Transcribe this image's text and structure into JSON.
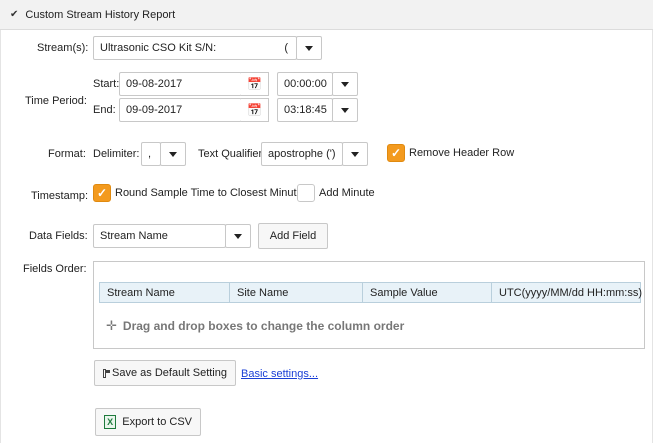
{
  "header": {
    "title": "Custom Stream History Report"
  },
  "stream": {
    "label": "Stream(s):",
    "value": "Ultrasonic CSO Kit S/N:",
    "extra": "("
  },
  "time_period": {
    "label": "Time Period:",
    "start_label": "Start:",
    "start_date": "09-08-2017",
    "start_time": "00:00:00",
    "end_label": "End:",
    "end_date": "09-09-2017",
    "end_time": "03:18:45"
  },
  "format": {
    "label": "Format:",
    "delimiter_label": "Delimiter:",
    "delimiter_value": ",",
    "qualifier_label": "Text Qualifier:",
    "qualifier_value": "apostrophe (')",
    "remove_header_label": "Remove Header Row",
    "remove_header_checked": true
  },
  "timestamp": {
    "label": "Timestamp:",
    "round_label": "Round Sample Time to Closest Minute",
    "round_checked": true,
    "add_minute_label": "Add Minute",
    "add_minute_checked": false
  },
  "data_fields": {
    "label": "Data Fields:",
    "value": "Stream Name",
    "add_label": "Add Field"
  },
  "fields_order": {
    "label": "Fields Order:",
    "columns": [
      "Stream Name",
      "Site Name",
      "Sample Value",
      "UTC(yyyy/MM/dd HH:mm:ss)"
    ],
    "hint": "Drag and drop boxes to change the column order"
  },
  "actions": {
    "save_default_label": "Save as Default Setting",
    "basic_settings_label": "Basic settings...",
    "export_label": "Export to CSV"
  },
  "colors": {
    "accent": "#f39a1e",
    "header_bg": "#f2f2f2",
    "column_bg": "#e8f2f8",
    "link": "#1a3fd6"
  },
  "icons": [
    "chevron-down-icon",
    "caret-down-icon",
    "calendar-icon",
    "check-icon",
    "move-icon",
    "floppy-disk-icon",
    "excel-icon"
  ]
}
